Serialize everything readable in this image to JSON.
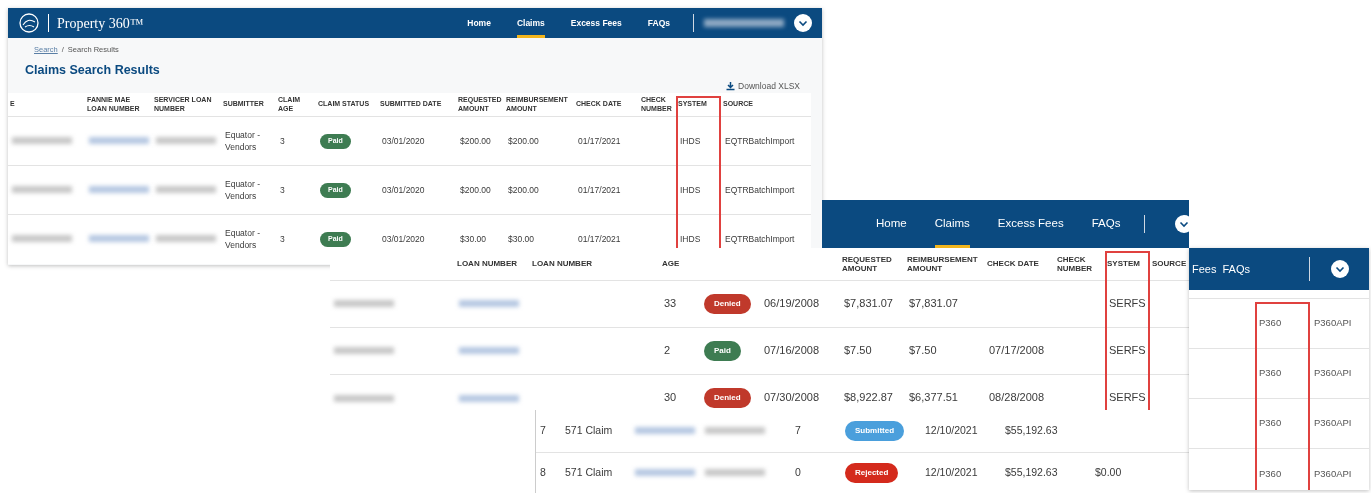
{
  "panels": [
    {
      "nav": {
        "brand": "Property 360™",
        "links": [
          {
            "label": "Home",
            "selected": false
          },
          {
            "label": "Claims",
            "selected": true
          },
          {
            "label": "Excess Fees",
            "selected": false
          },
          {
            "label": "FAQs",
            "selected": false
          }
        ],
        "account": {
          "name_blurred": true
        }
      },
      "breadcrumb": {
        "items": [
          "Search",
          "Search Results"
        ],
        "separator": "/"
      },
      "title": "Claims Search Results",
      "download": "Download XLSX",
      "table": {
        "columns": [
          {
            "label": "E",
            "highlighted": false
          },
          {
            "label": "FANNIE MAE LOAN NUMBER",
            "highlighted": false
          },
          {
            "label": "SERVICER LOAN NUMBER",
            "highlighted": false
          },
          {
            "label": "SUBMITTER",
            "highlighted": false
          },
          {
            "label": "CLAIM AGE",
            "highlighted": false
          },
          {
            "label": "CLAIM STATUS",
            "highlighted": false
          },
          {
            "label": "SUBMITTED DATE",
            "highlighted": false
          },
          {
            "label": "REQUESTED AMOUNT",
            "highlighted": false
          },
          {
            "label": "REIMBURSEMENT AMOUNT",
            "highlighted": false
          },
          {
            "label": "CHECK DATE",
            "highlighted": false
          },
          {
            "label": "CHECK NUMBER",
            "highlighted": false
          },
          {
            "label": "SYSTEM",
            "highlighted": true
          },
          {
            "label": "SOURCE",
            "highlighted": false
          }
        ],
        "rows": [
          [
            {
              "kind": "blurred"
            },
            {
              "kind": "blurred_link"
            },
            {
              "kind": "blurred"
            },
            "Equator - Vendors",
            "3",
            {
              "kind": "status",
              "label": "Paid",
              "color": "#3e7c52"
            },
            "03/01/2020",
            "$200.00",
            "$200.00",
            "01/17/2021",
            {
              "kind": "blank"
            },
            "IHDS",
            "EQTRBatchImport"
          ],
          [
            {
              "kind": "blurred"
            },
            {
              "kind": "blurred_link"
            },
            {
              "kind": "blurred"
            },
            "Equator - Vendors",
            "3",
            {
              "kind": "status",
              "label": "Paid",
              "color": "#3e7c52"
            },
            "03/01/2020",
            "$200.00",
            "$200.00",
            "01/17/2021",
            {
              "kind": "blank"
            },
            "IHDS",
            "EQTRBatchImport"
          ],
          [
            {
              "kind": "blurred"
            },
            {
              "kind": "blurred_link"
            },
            {
              "kind": "blurred"
            },
            "Equator - Vendors",
            "3",
            {
              "kind": "status",
              "label": "Paid",
              "color": "#3e7c52"
            },
            "03/01/2020",
            "$30.00",
            "$30.00",
            "01/17/2021",
            {
              "kind": "blank"
            },
            "IHDS",
            "EQTRBatchImport"
          ]
        ]
      }
    },
    {
      "nav": {
        "links": [
          {
            "label": "Home",
            "selected": false
          },
          {
            "label": "Claims",
            "selected": true
          },
          {
            "label": "Excess Fees",
            "selected": false
          },
          {
            "label": "FAQs",
            "selected": false
          }
        ],
        "account": {
          "name_blurred": false
        }
      }
    },
    {
      "table": {
        "columns": [
          {
            "highlighted": false
          },
          {
            "label": "LOAN NUMBER",
            "highlighted": false
          },
          {
            "label": "LOAN NUMBER",
            "highlighted": false
          },
          {
            "label": "AGE",
            "highlighted": false
          },
          {
            "highlighted": false
          },
          {
            "highlighted": false
          },
          {
            "label": "REQUESTED AMOUNT",
            "highlighted": false
          },
          {
            "label": "REIMBURSEMENT AMOUNT",
            "highlighted": false
          },
          {
            "label": "CHECK DATE",
            "highlighted": false
          },
          {
            "label": "CHECK NUMBER",
            "highlighted": false
          },
          {
            "label": "SYSTEM",
            "highlighted": true
          },
          {
            "label": "SOURCE",
            "highlighted": false
          }
        ],
        "rows": [
          [
            {
              "kind": "blurred"
            },
            {
              "kind": "blurred_link"
            },
            {
              "kind": "blank"
            },
            "33",
            {
              "kind": "status",
              "label": "Denied",
              "color": "#c0392b"
            },
            "06/19/2008",
            "$7,831.07",
            "$7,831.07",
            {
              "kind": "blank"
            },
            {
              "kind": "blank"
            },
            "SERFS",
            {
              "kind": "blank"
            }
          ],
          [
            {
              "kind": "blurred"
            },
            {
              "kind": "blurred_link"
            },
            {
              "kind": "blank"
            },
            "2",
            {
              "kind": "status",
              "label": "Paid",
              "color": "#3e7c52"
            },
            "07/16/2008",
            "$7.50",
            "$7.50",
            "07/17/2008",
            {
              "kind": "blank"
            },
            "SERFS",
            {
              "kind": "blank"
            }
          ],
          [
            {
              "kind": "blurred"
            },
            {
              "kind": "blurred_link"
            },
            {
              "kind": "blank"
            },
            "30",
            {
              "kind": "status",
              "label": "Denied",
              "color": "#c0392b"
            },
            "07/30/2008",
            "$8,922.87",
            "$6,377.51",
            "08/28/2008",
            {
              "kind": "blank"
            },
            "SERFS",
            {
              "kind": "blank"
            }
          ]
        ]
      }
    },
    {
      "table": {
        "columns": [
          {
            "highlighted": false
          },
          {
            "highlighted": false
          },
          {
            "highlighted": false
          },
          {
            "highlighted": false
          },
          {
            "highlighted": false
          },
          {
            "highlighted": false
          },
          {
            "highlighted": false
          },
          {
            "highlighted": false
          },
          {
            "highlighted": false
          },
          {
            "highlighted": false
          }
        ],
        "rows": [
          [
            "7",
            "571 Claim",
            {
              "kind": "blurred_link"
            },
            {
              "kind": "blurred"
            },
            "7",
            {
              "kind": "status",
              "label": "Submitted",
              "color": "#4a9fdc"
            },
            "12/10/2021",
            "$55,192.63",
            {
              "kind": "blank"
            },
            {
              "kind": "blank"
            }
          ],
          [
            "8",
            "571 Claim",
            {
              "kind": "blurred_link"
            },
            {
              "kind": "blurred"
            },
            "0",
            {
              "kind": "status",
              "label": "Rejected",
              "color": "#d42a1c"
            },
            "12/10/2021",
            "$55,192.63",
            "$0.00",
            {
              "kind": "blank"
            }
          ]
        ]
      }
    },
    {
      "nav": {
        "links": [
          {
            "label": "Fees",
            "selected": false
          },
          {
            "label": "FAQs",
            "selected": false
          }
        ],
        "account": {
          "name_blurred": false
        }
      },
      "table": {
        "columns": [
          {
            "highlighted": false
          },
          {
            "highlighted": true
          },
          {
            "highlighted": false
          }
        ],
        "rows": [
          [
            {
              "kind": "blank"
            },
            "P360",
            "P360API"
          ],
          [
            {
              "kind": "blank"
            },
            "P360",
            "P360API"
          ],
          [
            {
              "kind": "blank"
            },
            "P360",
            "P360API"
          ],
          [
            {
              "kind": "blank"
            },
            "P360",
            "P360API"
          ]
        ]
      }
    }
  ]
}
